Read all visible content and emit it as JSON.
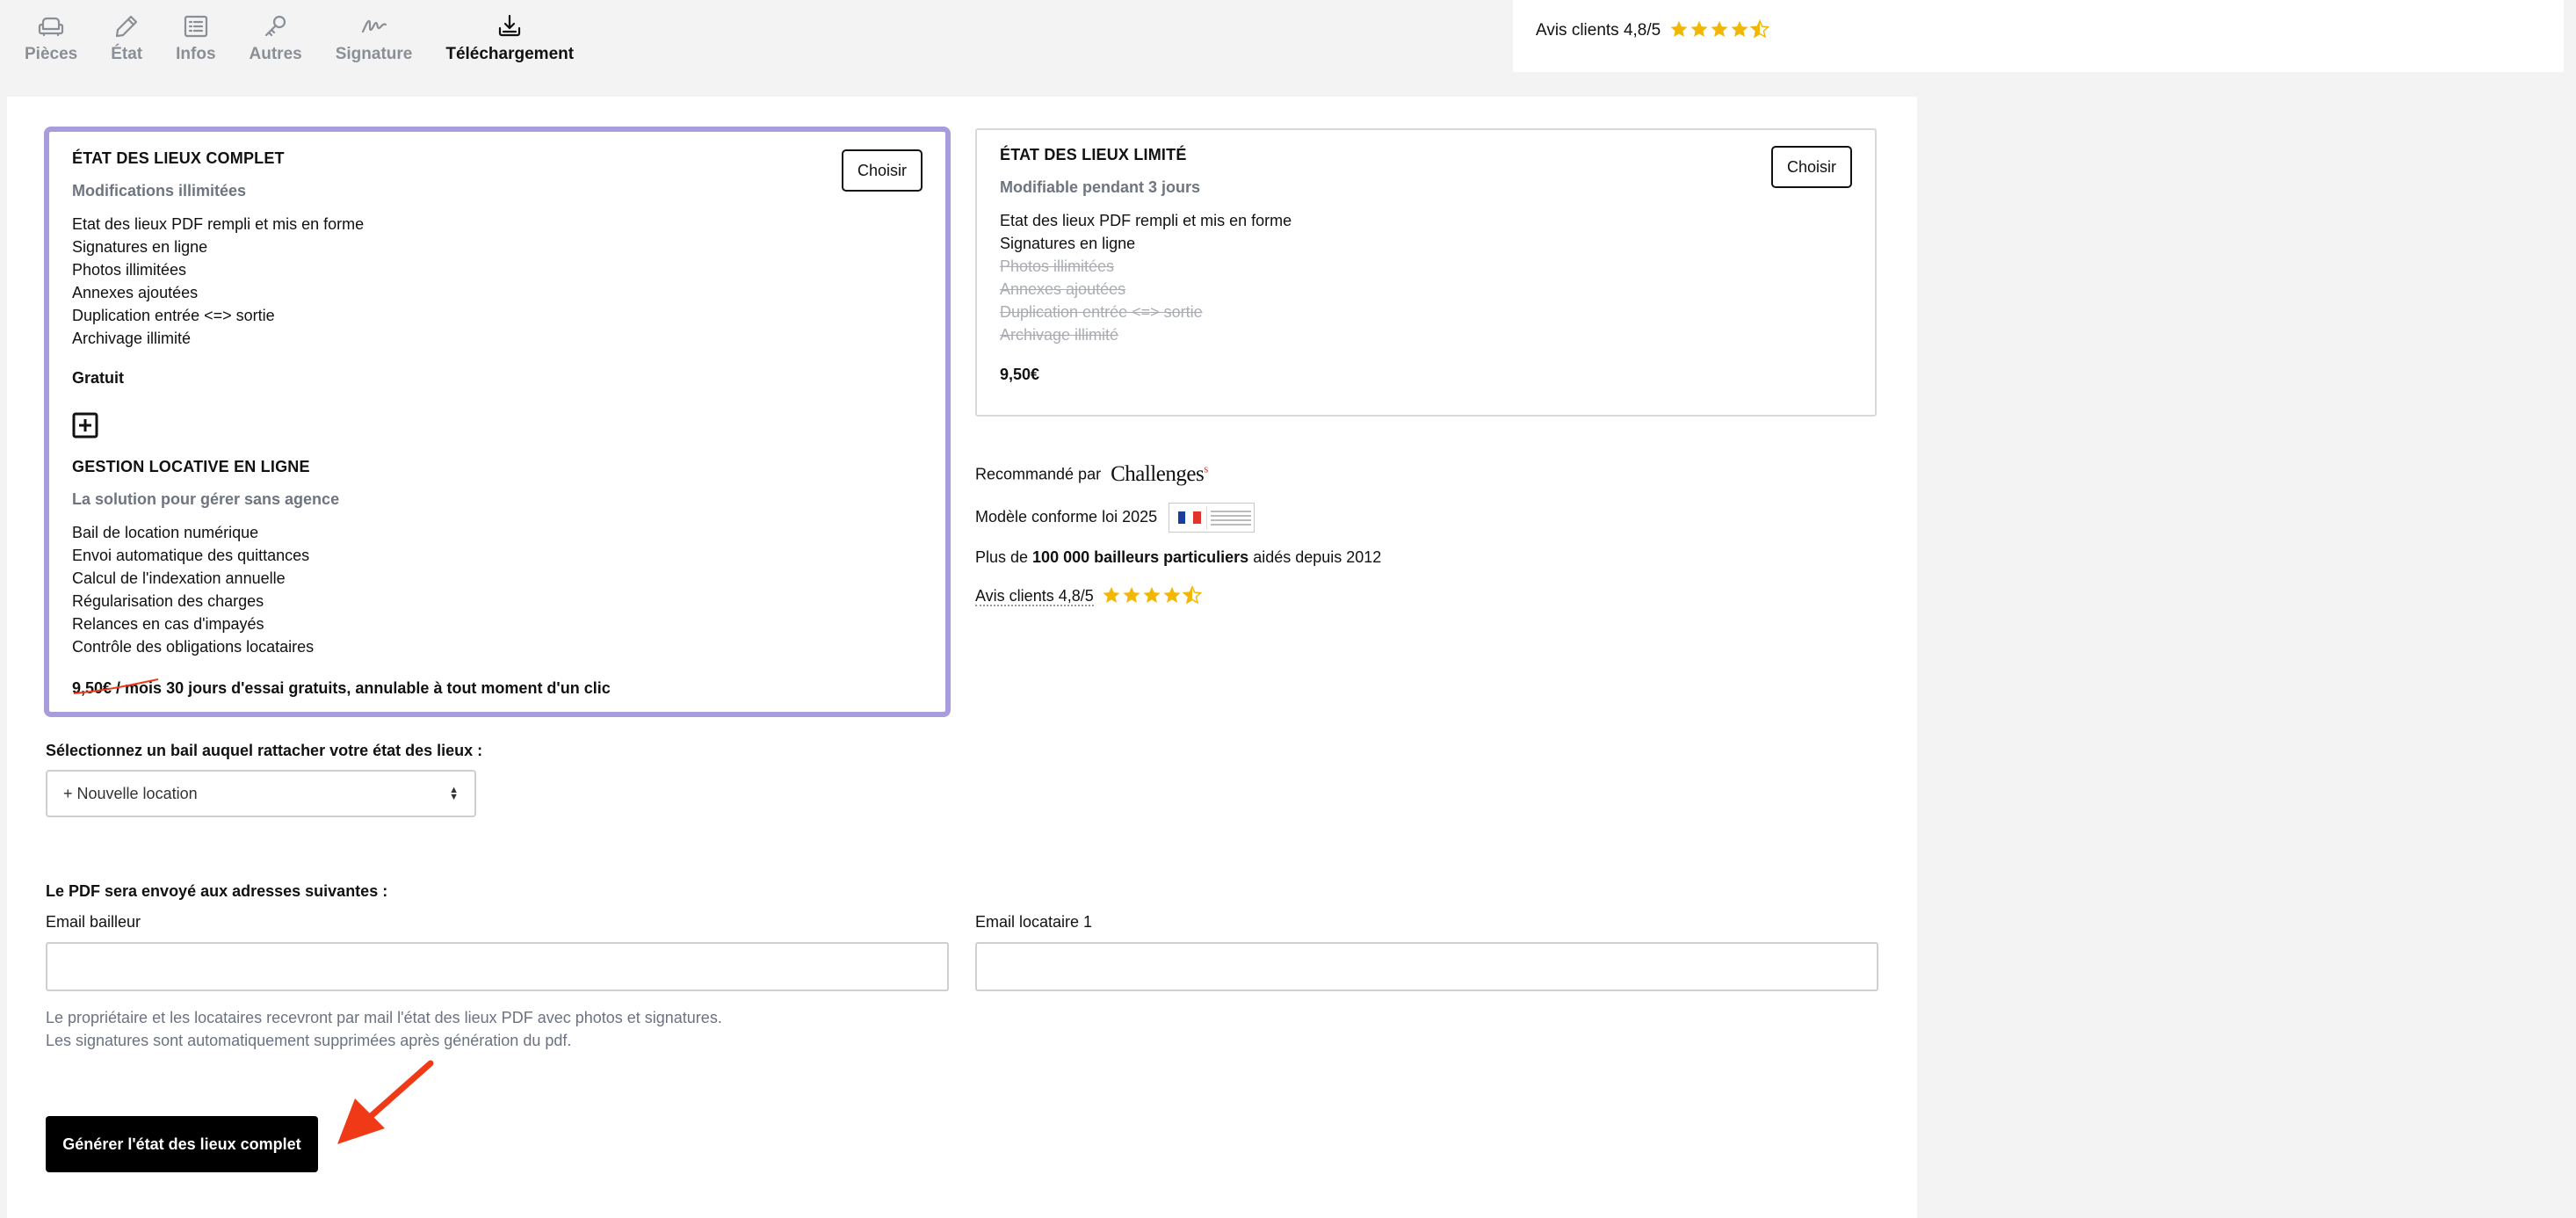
{
  "nav": {
    "tabs": [
      {
        "label": "Pièces",
        "icon": "sofa-icon"
      },
      {
        "label": "État",
        "icon": "pencil-icon"
      },
      {
        "label": "Infos",
        "icon": "list-icon"
      },
      {
        "label": "Autres",
        "icon": "key-icon"
      },
      {
        "label": "Signature",
        "icon": "signature-icon"
      },
      {
        "label": "Téléchargement",
        "icon": "download-icon",
        "active": true
      }
    ]
  },
  "top_rating": {
    "text": "Avis clients 4,8/5",
    "rating": 4.5
  },
  "cards": {
    "complete": {
      "title": "ÉTAT DES LIEUX COMPLET",
      "button": "Choisir",
      "subtitle": "Modifications illimitées",
      "features": [
        "Etat des lieux PDF rempli et mis en forme",
        "Signatures en ligne",
        "Photos illimitées",
        "Annexes ajoutées",
        "Duplication entrée <=> sortie",
        "Archivage illimité"
      ],
      "price": "Gratuit",
      "addon": {
        "title": "GESTION LOCATIVE EN LIGNE",
        "subtitle": "La solution pour gérer sans agence",
        "features": [
          "Bail de location numérique",
          "Envoi automatique des quittances",
          "Calcul de l'indexation annuelle",
          "Régularisation des charges",
          "Relances en cas d'impayés",
          "Contrôle des obligations locataires"
        ],
        "old_price": "9,50€ / mois",
        "offer": " 30 jours d'essai gratuits, annulable à tout moment d'un clic"
      }
    },
    "limited": {
      "title": "ÉTAT DES LIEUX LIMITÉ",
      "button": "Choisir",
      "subtitle": "Modifiable pendant 3 jours",
      "features_included": [
        "Etat des lieux PDF rempli et mis en forme",
        "Signatures en ligne"
      ],
      "features_excluded": [
        "Photos illimitées",
        "Annexes ajoutées",
        "Duplication entrée <=> sortie",
        "Archivage illimité"
      ],
      "price": "9,50€"
    }
  },
  "trust": {
    "recommended": "Recommandé par",
    "challenges_logo": "Challenges",
    "model": "Modèle conforme loi 2025",
    "landlords_prefix": "Plus de ",
    "landlords_bold": "100 000 bailleurs particuliers",
    "landlords_suffix": " aidés depuis 2012",
    "rating_text": "Avis clients 4,8/5",
    "rating": 4.5
  },
  "form": {
    "lease_label": "Sélectionnez un bail auquel rattacher votre état des lieux :",
    "lease_selected": "+ Nouvelle location",
    "pdf_label": "Le PDF sera envoyé aux adresses suivantes :",
    "email_landlord_label": "Email bailleur",
    "email_landlord_value": "",
    "email_tenant_label": "Email locataire 1",
    "email_tenant_value": "",
    "note_line1": "Le propriétaire et les locataires recevront par mail l'état des lieux PDF avec photos et signatures.",
    "note_line2": "Les signatures sont automatiquement supprimées après génération du pdf.",
    "generate_button": "Générer l'état des lieux complet"
  },
  "colors": {
    "selected_border": "#a99cdd",
    "star": "#f2b705",
    "arrow": "#f03a17",
    "muted": "#6f7580"
  }
}
